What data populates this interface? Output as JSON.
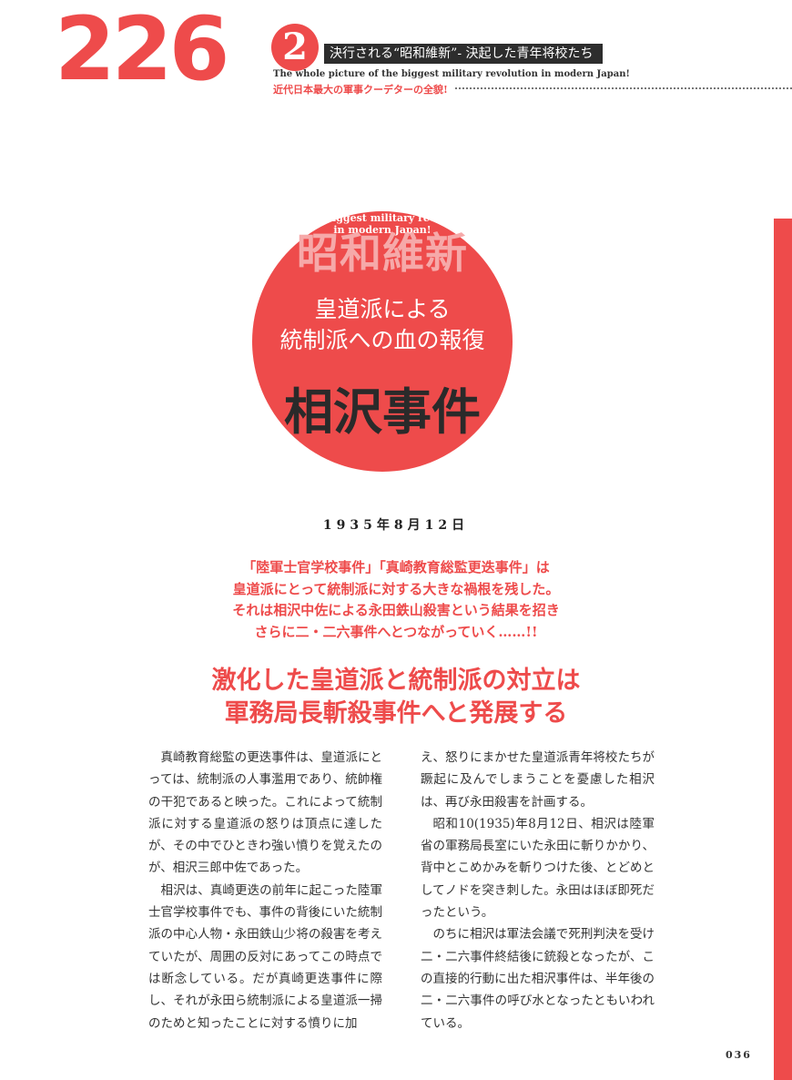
{
  "header": {
    "big_number": "226",
    "chapter": "2",
    "series_title": "決行される“昭和維新”- 決起した青年将校たち",
    "english_subtitle": "The whole picture of the biggest military revolution in modern Japan!",
    "jp_subtitle": "近代日本最大の軍事クーデターの全貌!"
  },
  "hero": {
    "english": "The whole picture\nof the biggest military revolution\nin modern Japan!",
    "showa": "昭和維新",
    "subtitle": "皇道派による\n統制派への血の報復",
    "main_title": "相沢事件"
  },
  "date": "1935年8月12日",
  "lead": "「陸軍士官学校事件」「真崎教育総監更迭事件」は\n皇道派にとって統制派に対する大きな禍根を残した。\nそれは相沢中佐による永田鉄山殺害という結果を招き\nさらに二・二六事件へとつながっていく……!!",
  "headline": "激化した皇道派と統制派の対立は\n軍務局長斬殺事件へと発展する",
  "body": {
    "left": [
      "真崎教育総監の更迭事件は、皇道派にとっては、統制派の人事濫用であり、統帥権の干犯であると映った。これによって統制派に対する皇道派の怒りは頂点に達したが、その中でひときわ強い憤りを覚えたのが、相沢三郎中佐であった。",
      "相沢は、真崎更迭の前年に起こった陸軍士官学校事件でも、事件の背後にいた統制派の中心人物・永田鉄山少将の殺害を考えていたが、周囲の反対にあってこの時点では断念している。だが真崎更迭事件に際し、それが永田ら統制派による皇道派一掃のためと知ったことに対する憤りに加"
    ],
    "right": [
      "え、怒りにまかせた皇道派青年将校たちが蹶起に及んでしまうことを憂慮した相沢は、再び永田殺害を計画する。",
      "昭和10(1935)年8月12日、相沢は陸軍省の軍務局長室にいた永田に斬りかかり、背中とこめかみを斬りつけた後、とどめとしてノドを突き刺した。永田はほぼ即死だったという。",
      "のちに相沢は軍法会議で死刑判決を受け二・二六事件終結後に銃殺となったが、この直接的行動に出た相沢事件は、半年後の二・二六事件の呼び水となったともいわれている。"
    ]
  },
  "page_number": "036",
  "colors": {
    "accent": "#ee4b4b",
    "dark": "#2d2d2d"
  }
}
